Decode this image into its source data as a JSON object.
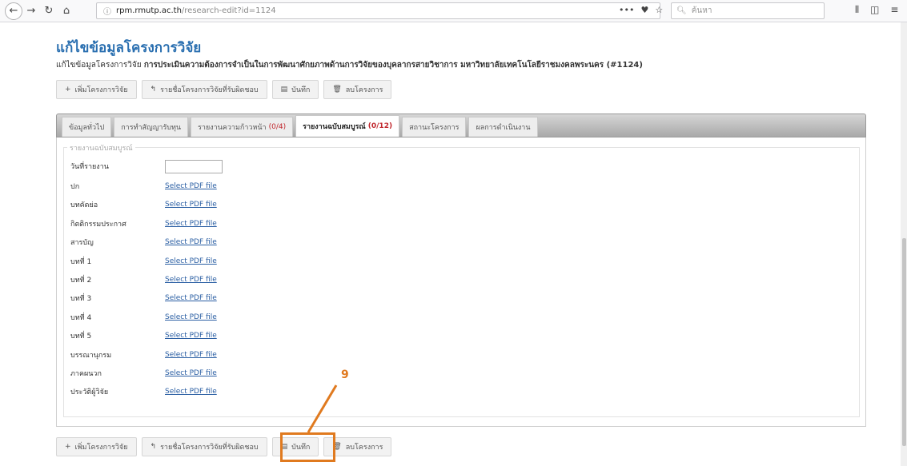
{
  "browser": {
    "url_info": "ⓘ",
    "url_domain": "rpm.rmutp.ac.th",
    "url_path": "/research-edit?id=1124",
    "search_placeholder": "ค้นหา",
    "menu_dots": "•••"
  },
  "page": {
    "title": "แก้ไขข้อมูลโครงการวิจัย",
    "subtitle_prefix": "แก้ไขข้อมูลโครงการวิจัย",
    "subtitle_bold": "การประเมินความต้องการจำเป็นในการพัฒนาศักยภาพด้านการวิจัยของบุคลากรสายวิชาการ มหาวิทยาลัยเทคโนโลยีราชมงคลพระนคร (#1124)"
  },
  "actions": {
    "add_label": "เพิ่มโครงการวิจัย",
    "list_label": "รายชื่อโครงการวิจัยที่รับผิดชอบ",
    "save_label": "บันทึก",
    "delete_label": "ลบโครงการ"
  },
  "tabs": [
    {
      "label": "ข้อมูลทั่วไป",
      "count": ""
    },
    {
      "label": "การทำสัญญารับทุน",
      "count": ""
    },
    {
      "label": "รายงานความก้าวหน้า",
      "count": "(0/4)"
    },
    {
      "label": "รายงานฉบับสมบูรณ์",
      "count": "(0/12)"
    },
    {
      "label": "สถานะโครงการ",
      "count": ""
    },
    {
      "label": "ผลการดำเนินงาน",
      "count": ""
    }
  ],
  "report": {
    "legend": "รายงานฉบับสมบูรณ์",
    "date_label": "วันที่รายงาน",
    "link_text": "Select PDF file",
    "items": [
      "ปก",
      "บทคัดย่อ",
      "กิตติกรรมประกาศ",
      "สารบัญ",
      "บทที่ 1",
      "บทที่ 2",
      "บทที่ 3",
      "บทที่ 4",
      "บทที่ 5",
      "บรรณานุกรม",
      "ภาคผนวก",
      "ประวัติผู้วิจัย"
    ]
  },
  "annotation": {
    "step": "9",
    "color": "#e07a1f"
  }
}
